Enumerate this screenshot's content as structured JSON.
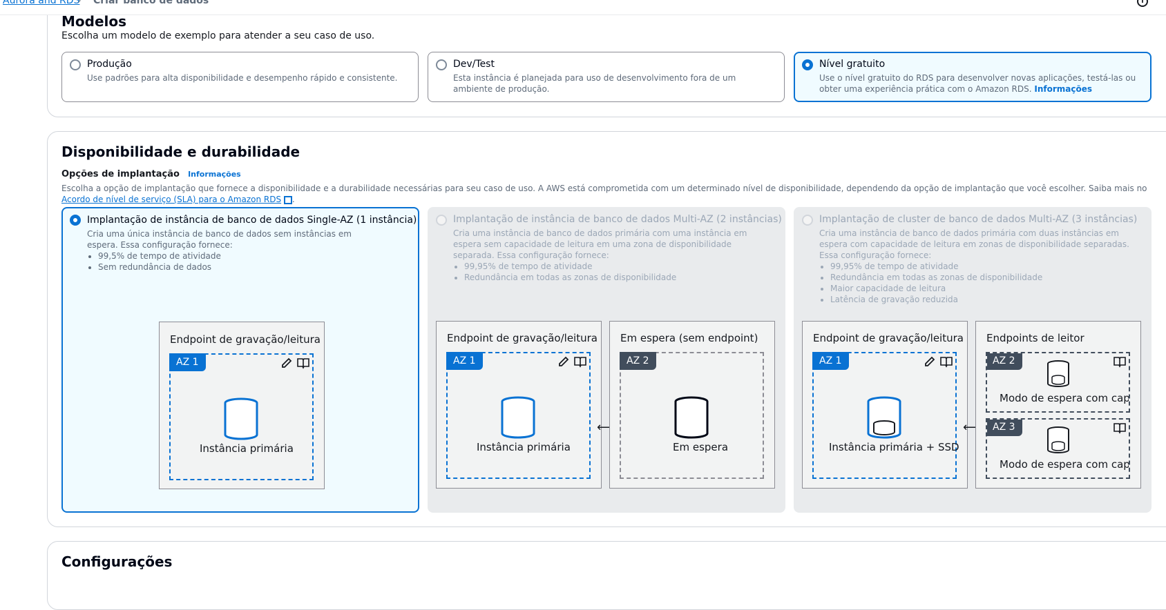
{
  "breadcrumb": {
    "parent": "Aurora and RDS",
    "current": "Criar banco de dados",
    "separator": "›"
  },
  "templates": {
    "title": "Modelos",
    "description": "Escolha um modelo de exemplo para atender a seu caso de uso.",
    "options": [
      {
        "label": "Produção",
        "description": "Use padrões para alta disponibilidade e desempenho rápido e consistente.",
        "selected": false
      },
      {
        "label": "Dev/Test",
        "description": "Esta instância é planejada para uso de desenvolvimento fora de um ambiente de produção.",
        "selected": false
      },
      {
        "label": "Nível gratuito",
        "description": "Use o nível gratuito do RDS para desenvolver novas aplicações, testá-las ou obter uma experiência prática com o Amazon RDS.",
        "info": "Informações",
        "selected": true
      }
    ]
  },
  "availability": {
    "title": "Disponibilidade e durabilidade",
    "options_label": "Opções de implantação",
    "info": "Informações",
    "description": "Escolha a opção de implantação que fornece a disponibilidade e a durabilidade necessárias para seu caso de uso. A AWS está comprometida com um determinado nível de disponibilidade, dependendo da opção de implantação que você escolher. Saiba mais no",
    "sla_link": "Acordo de nível de serviço (SLA) para o Amazon RDS",
    "deployments": [
      {
        "label": "Implantação de instância de banco de dados Single-AZ (1 instância)",
        "description": "Cria uma única instância de banco de dados sem instâncias em espera. Essa configuração fornece:",
        "bullets": [
          "99,5% de tempo de atividade",
          "Sem redundância de dados"
        ],
        "selected": true,
        "disabled": false
      },
      {
        "label": "Implantação de instância de banco de dados Multi-AZ (2 instâncias)",
        "description": "Cria uma instância de banco de dados primária com uma instância em espera sem capacidade de leitura em uma zona de disponibilidade separada. Essa configuração fornece:",
        "bullets": [
          "99,95% de tempo de atividade",
          "Redundância em todas as zonas de disponibilidade"
        ],
        "selected": false,
        "disabled": true
      },
      {
        "label": "Implantação de cluster de banco de dados Multi-AZ (3 instâncias)",
        "description": "Cria uma instância de banco de dados primária com duas instâncias em espera com capacidade de leitura em zonas de disponibilidade separadas. Essa configuração fornece:",
        "bullets": [
          "99,95% de tempo de atividade",
          "Redundância em todas as zonas de disponibilidade",
          "Maior capacidade de leitura",
          "Latência de gravação reduzida"
        ],
        "selected": false,
        "disabled": true
      }
    ],
    "diagrams": {
      "rw_endpoint": "Endpoint de gravação/leitura",
      "standby_endpoint": "Em espera (sem endpoint)",
      "reader_endpoints": "Endpoints de leitor",
      "az1": "AZ 1",
      "az2": "AZ 2",
      "az3": "AZ 3",
      "primary": "Instância primária",
      "standby": "Em espera",
      "primary_ssd": "Instância primária + SSD",
      "readable_standby": "Modo de espera com capacidade de leitura"
    }
  },
  "configurations": {
    "title": "Configurações"
  }
}
